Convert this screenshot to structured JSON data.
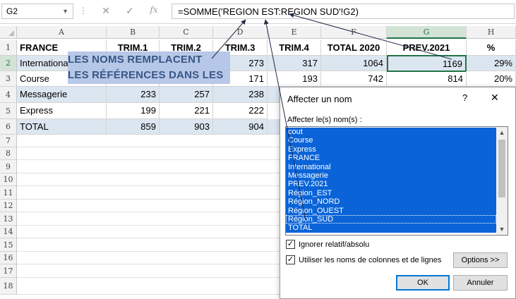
{
  "formula_bar": {
    "name_box": "G2",
    "fx": "fx",
    "formula": "=SOMME('REGION EST:REGION SUD'!G2)"
  },
  "columns": [
    "A",
    "B",
    "C",
    "D",
    "E",
    "F",
    "G",
    "H"
  ],
  "rows": [
    "1",
    "2",
    "3",
    "4",
    "5",
    "6",
    "7",
    "8",
    "9",
    "10",
    "11",
    "12",
    "13",
    "14",
    "15",
    "16",
    "17",
    "18"
  ],
  "table": {
    "headers": [
      "FRANCE",
      "TRIM.1",
      "TRIM.2",
      "TRIM.3",
      "TRIM.4",
      "TOTAL 2020",
      "PREV.2021",
      "%"
    ],
    "r2": [
      "Internationa",
      "",
      "",
      "273",
      "317",
      "1064",
      "1169",
      "29%"
    ],
    "r3": [
      "Course",
      "",
      "",
      "171",
      "193",
      "742",
      "814",
      "20%"
    ],
    "r4": [
      "Messagerie",
      "233",
      "257",
      "238"
    ],
    "r5": [
      "Express",
      "199",
      "221",
      "222"
    ],
    "r6": [
      "TOTAL",
      "859",
      "903",
      "904"
    ]
  },
  "overlay": {
    "line1": "LES NOMS REMPLACENT",
    "line2": "LES RÉFÉRENCES DANS LES"
  },
  "dialog": {
    "title": "Affecter un nom",
    "help": "?",
    "close": "✕",
    "list_label": "Affecter le(s) nom(s) :",
    "names": [
      "cout",
      "Course",
      "Express",
      "FRANCE",
      "International",
      "Messagerie",
      "PREV.2021",
      "Région_EST",
      "Région_NORD",
      "Région_OUEST",
      "Région_SUD",
      "TOTAL"
    ],
    "check1": {
      "label": "Ignorer relatif/absolu",
      "checked": true
    },
    "check2": {
      "label": "Utiliser les noms de colonnes et de lignes",
      "checked": true
    },
    "options_btn": "Options >>",
    "ok_btn": "OK",
    "cancel_btn": "Annuler"
  }
}
